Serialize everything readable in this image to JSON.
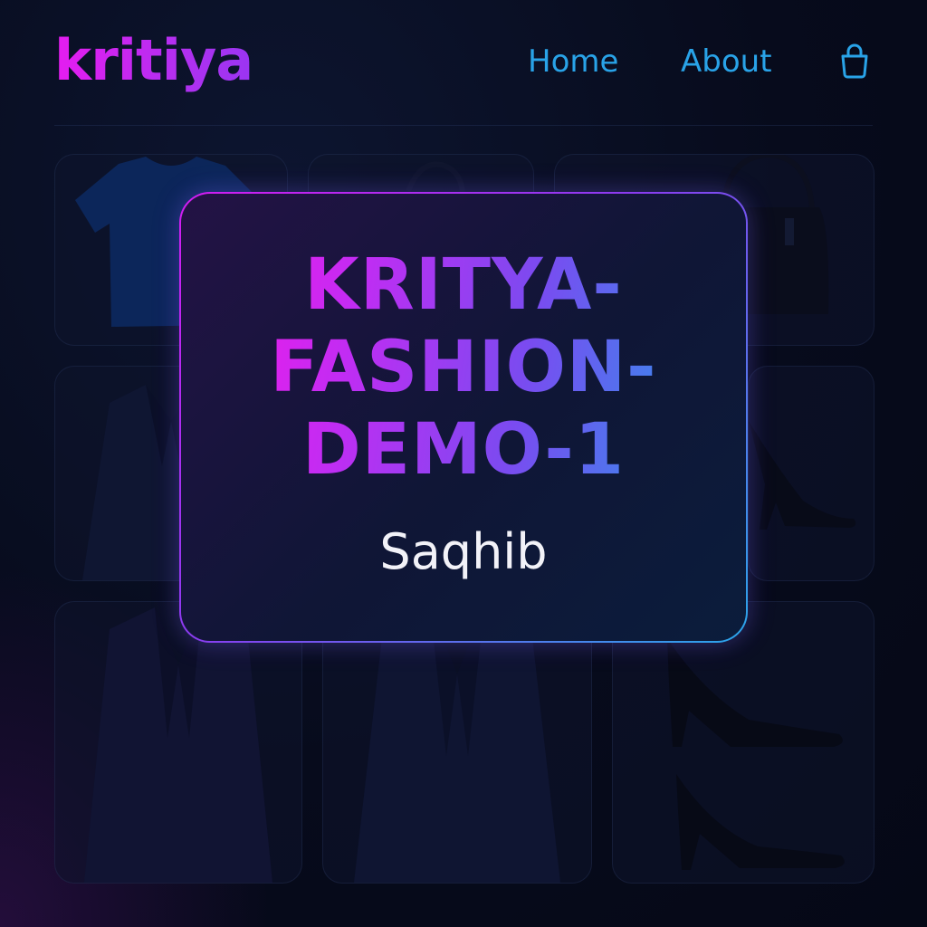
{
  "header": {
    "logo": "kritiya",
    "nav": [
      {
        "label": "Home"
      },
      {
        "label": "About"
      }
    ],
    "cart_icon": "shopping-bag-icon"
  },
  "hero": {
    "title_lines": [
      "KRITYA-",
      "FASHION-",
      "DEMO-1"
    ],
    "subtitle": "Saqhib"
  },
  "products": [
    {
      "icon": "tshirt-icon"
    },
    {
      "icon": "handbag-icon"
    },
    {
      "icon": "handbag-icon"
    },
    {
      "icon": "blazer-icon"
    },
    {
      "icon": "high-heel-icon"
    },
    {
      "icon": "blazer-icon"
    },
    {
      "icon": "blazer-icon"
    },
    {
      "icon": "high-heel-icon"
    }
  ],
  "colors": {
    "accent_magenta": "#e51cf0",
    "accent_blue": "#29a3e8",
    "background": "#070b1c"
  }
}
